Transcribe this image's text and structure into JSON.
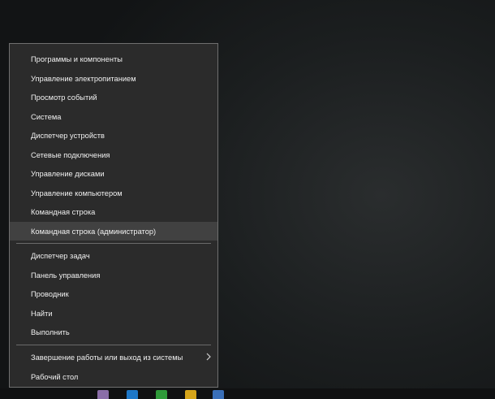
{
  "menu": {
    "items": [
      {
        "label": "Программы и компоненты"
      },
      {
        "label": "Управление электропитанием"
      },
      {
        "label": "Просмотр событий"
      },
      {
        "label": "Система"
      },
      {
        "label": "Диспетчер устройств"
      },
      {
        "label": "Сетевые подключения"
      },
      {
        "label": "Управление дисками"
      },
      {
        "label": "Управление компьютером"
      },
      {
        "label": "Командная строка"
      },
      {
        "label": "Командная строка (администратор)",
        "highlighted": true
      },
      {
        "label": "Диспетчер задач"
      },
      {
        "label": "Панель управления"
      },
      {
        "label": "Проводник"
      },
      {
        "label": "Найти"
      },
      {
        "label": "Выполнить"
      },
      {
        "label": "Завершение работы или выход из системы",
        "has_submenu": true
      },
      {
        "label": "Рабочий стол"
      }
    ]
  },
  "icons": {
    "submenu": "chevron-right-icon"
  },
  "colors": {
    "menu_background": "#2b2b2b",
    "menu_highlight": "#414141",
    "menu_text": "#f0f0f0",
    "menu_border": "#6f6f6f"
  }
}
